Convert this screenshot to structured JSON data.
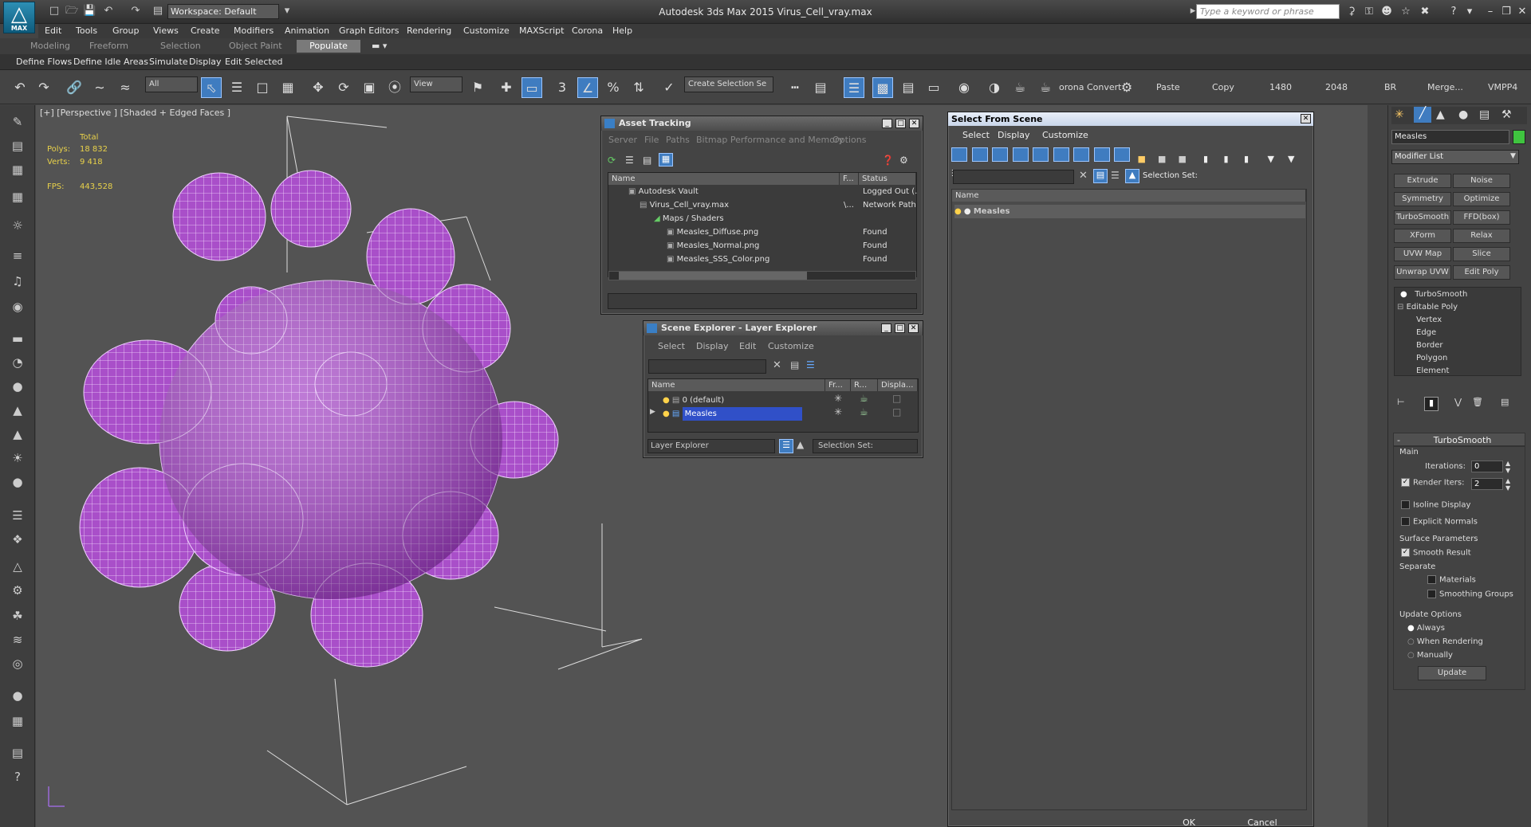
{
  "titlebar": {
    "logo": "MAX",
    "workspace": "Workspace: Default",
    "title": "Autodesk 3ds Max  2015    Virus_Cell_vray.max",
    "search_placeholder": "Type a keyword or phrase"
  },
  "menu": [
    "Edit",
    "Tools",
    "Group",
    "Views",
    "Create",
    "Modifiers",
    "Animation",
    "Graph Editors",
    "Rendering",
    "Customize",
    "MAXScript",
    "Corona",
    "Help"
  ],
  "ribbon": {
    "tabs": [
      "Modeling",
      "Freeform",
      "Selection",
      "Object Paint",
      "Populate"
    ],
    "active_tab": "Populate",
    "sub": [
      "Define Flows",
      "Define Idle Areas",
      "Simulate",
      "Display",
      "Edit Selected"
    ]
  },
  "toolbar": {
    "filter": "All",
    "coord": "View",
    "selection_set": "Create Selection Se",
    "corona_convert": "orona Convert",
    "paste": "Paste",
    "copy": "Copy",
    "v1480": "1480",
    "v2048": "2048",
    "br": "BR",
    "merge": "Merge...",
    "vmpp4": "VMPP4"
  },
  "viewport": {
    "label": "[+] [Perspective ] [Shaded + Edged Faces ]",
    "total_label": "Total",
    "polys_label": "Polys:",
    "polys": "18 832",
    "verts_label": "Verts:",
    "verts": "9 418",
    "fps_label": "FPS:",
    "fps": "443,528"
  },
  "asset_tracking": {
    "title": "Asset Tracking",
    "menu": [
      "Server",
      "File",
      "Paths",
      "Bitmap Performance and Memory",
      "Options"
    ],
    "columns": [
      "Name",
      "F...",
      "Status"
    ],
    "rows": [
      {
        "name": "Autodesk Vault",
        "f": "",
        "status": "Logged Out (..."
      },
      {
        "name": "Virus_Cell_vray.max",
        "f": "\\...",
        "status": "Network Path"
      },
      {
        "name": "Maps / Shaders",
        "f": "",
        "status": ""
      },
      {
        "name": "Measles_Diffuse.png",
        "f": "",
        "status": "Found"
      },
      {
        "name": "Measles_Normal.png",
        "f": "",
        "status": "Found"
      },
      {
        "name": "Measles_SSS_Color.png",
        "f": "",
        "status": "Found"
      }
    ]
  },
  "scene_explorer": {
    "title": "Scene Explorer - Layer Explorer",
    "menu": [
      "Select",
      "Display",
      "Edit",
      "Customize"
    ],
    "columns": [
      "Name",
      "Fr...",
      "R...",
      "Displa..."
    ],
    "rows": [
      "0 (default)",
      "Measles"
    ],
    "footer_left": "Layer Explorer",
    "footer_right": "Selection Set:"
  },
  "select_from_scene": {
    "title": "Select From Scene",
    "menu": [
      "Select",
      "Display",
      "Customize"
    ],
    "selection_set": "Selection Set:",
    "col_name": "Name",
    "items": [
      "Measles"
    ],
    "ok": "OK",
    "cancel": "Cancel"
  },
  "command_panel": {
    "object_name": "Measles",
    "object_color": "#3fc43f",
    "modifier_list": "Modifier List",
    "buttons": [
      "Extrude",
      "Noise",
      "Symmetry",
      "Optimize",
      "TurboSmooth",
      "FFD(box)",
      "XForm",
      "Relax",
      "UVW Map",
      "Slice",
      "Unwrap UVW",
      "Edit Poly"
    ],
    "stack": [
      "TurboSmooth",
      "Editable Poly",
      "Vertex",
      "Edge",
      "Border",
      "Polygon",
      "Element"
    ],
    "rollout_title": "TurboSmooth",
    "main_label": "Main",
    "iterations_label": "Iterations:",
    "iterations": "0",
    "render_iters_label": "Render Iters:",
    "render_iters": "2",
    "isoline": "Isoline Display",
    "explicit_normals": "Explicit Normals",
    "surface_params": "Surface Parameters",
    "smooth_result": "Smooth Result",
    "separate": "Separate",
    "materials": "Materials",
    "smoothing_groups": "Smoothing Groups",
    "update_options": "Update Options",
    "always": "Always",
    "when_rendering": "When Rendering",
    "manually": "Manually",
    "update_button": "Update"
  }
}
